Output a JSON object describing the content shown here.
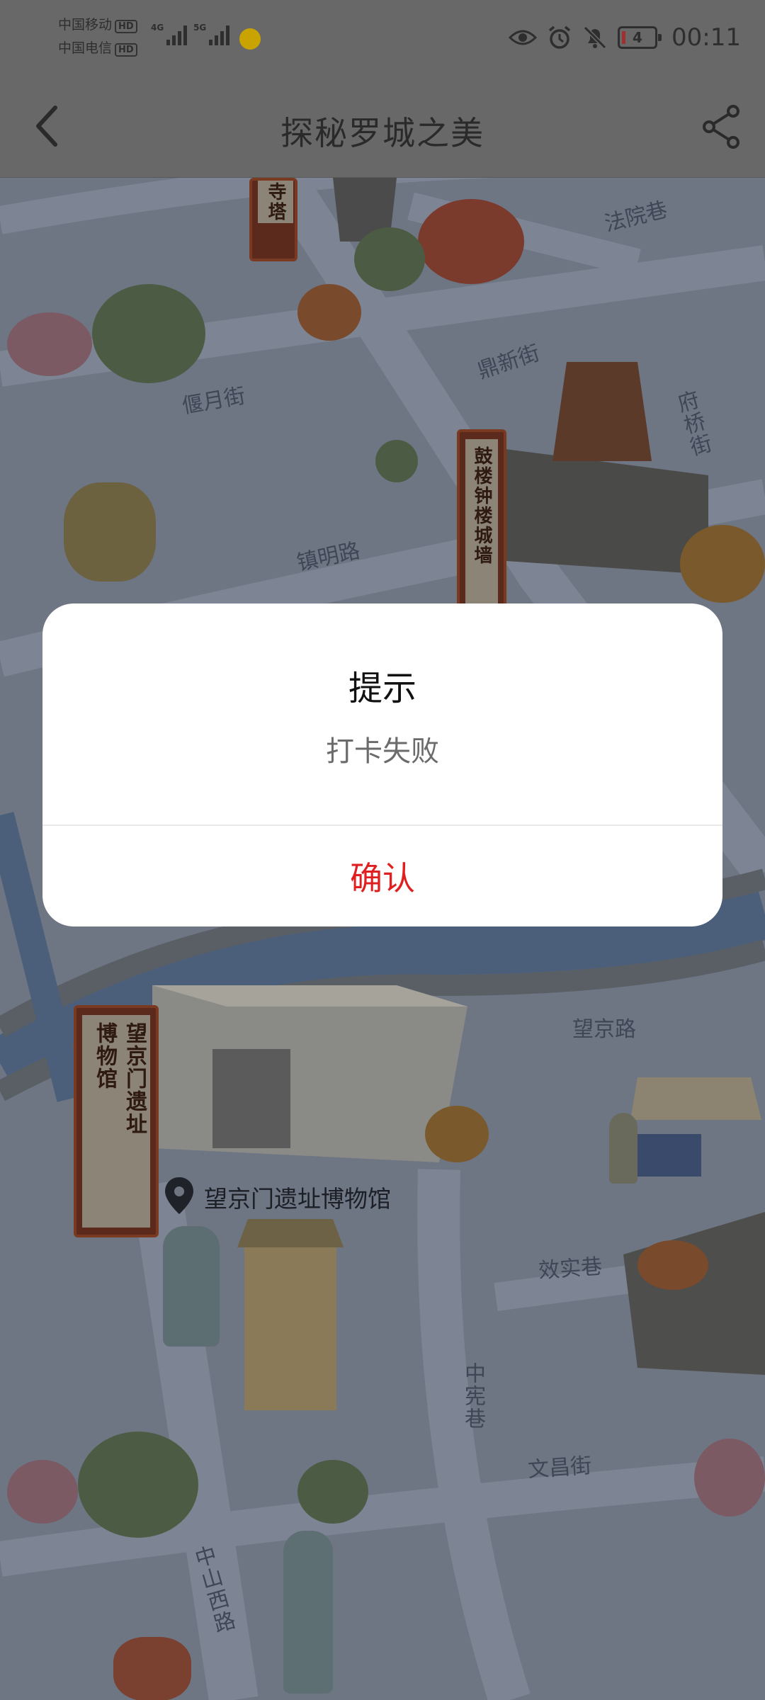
{
  "status_bar": {
    "carrier_1": "中国移动",
    "carrier_2": "中国电信",
    "hd_badge": "HD",
    "network_1": "4G",
    "network_2": "5G",
    "battery_level": "4",
    "time": "00:11",
    "icons": [
      "eye-icon",
      "alarm-icon",
      "mute-icon",
      "battery-icon"
    ]
  },
  "header": {
    "title": "探秘罗城之美",
    "back_icon": "chevron-left-icon",
    "share_icon": "share-icon"
  },
  "map": {
    "streets": [
      "法院巷",
      "偃月街",
      "鼎新街",
      "府桥街",
      "镇明路",
      "望京路",
      "效实巷",
      "中宪巷",
      "文昌街",
      "中山西路"
    ],
    "landmark_banners": {
      "temple_tower_fragment": "寺塔",
      "drum_tower": "鼓楼钟楼城墙",
      "museum_line_1": "望京门遗址",
      "museum_line_2": "博物馆"
    },
    "poi_label": "望京门遗址博物馆",
    "poi_icon": "location-pin-icon"
  },
  "dialog": {
    "title": "提示",
    "message": "打卡失败",
    "confirm_label": "确认"
  },
  "colors": {
    "accent_confirm": "#e02020",
    "overlay": "#6f7682"
  }
}
